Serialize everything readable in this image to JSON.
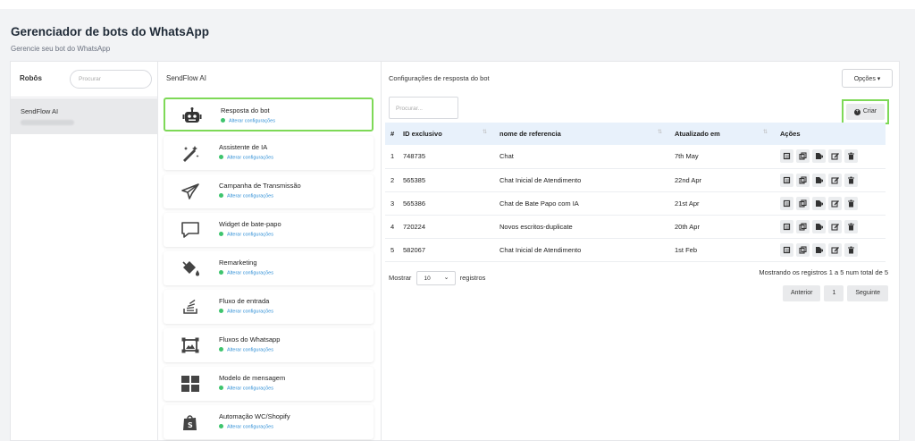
{
  "header": {
    "title": "Gerenciador de bots do WhatsApp",
    "subtitle": "Gerencie seu bot do WhatsApp"
  },
  "bots_panel": {
    "title": "Robôs",
    "search_placeholder": "Procurar",
    "items": [
      {
        "name": "SendFlow AI"
      }
    ]
  },
  "features_panel": {
    "title": "SendFlow AI",
    "items": [
      {
        "name": "Resposta do bot",
        "sub": "Alterar configurações",
        "icon": "robot-icon",
        "active": true
      },
      {
        "name": "Assistente de IA",
        "sub": "Alterar configurações",
        "icon": "magic-wand-icon"
      },
      {
        "name": "Campanha de Transmissão",
        "sub": "Alterar configurações",
        "icon": "paper-plane-icon"
      },
      {
        "name": "Widget de bate-papo",
        "sub": "Alterar configurações",
        "icon": "chat-bubble-icon"
      },
      {
        "name": "Remarketing",
        "sub": "Alterar configurações",
        "icon": "paint-bucket-icon"
      },
      {
        "name": "Fluxo de entrada",
        "sub": "Alterar configurações",
        "icon": "stack-icon"
      },
      {
        "name": "Fluxos do Whatsapp",
        "sub": "Alterar configurações",
        "icon": "frame-icon"
      },
      {
        "name": "Modelo de mensagem",
        "sub": "Alterar configurações",
        "icon": "grid-icon"
      },
      {
        "name": "Automação WC/Shopify",
        "sub": "Alterar configurações",
        "icon": "shopify-bag-icon"
      }
    ]
  },
  "config_panel": {
    "title": "Configurações de resposta do bot",
    "options_label": "Opções",
    "search_placeholder": "Procurar...",
    "create_label": "Criar",
    "columns": [
      "#",
      "ID exclusivo",
      "nome de referencia",
      "Atualizado em",
      "Ações"
    ],
    "rows": [
      {
        "n": "1",
        "id": "748735",
        "name": "Chat",
        "updated": "7th May"
      },
      {
        "n": "2",
        "id": "565385",
        "name": "Chat Inicial de Atendimento",
        "updated": "22nd Apr"
      },
      {
        "n": "3",
        "id": "565386",
        "name": "Chat de Bate Papo com IA",
        "updated": "21st Apr"
      },
      {
        "n": "4",
        "id": "720224",
        "name": "Novos escritos-duplicate",
        "updated": "20th Apr"
      },
      {
        "n": "5",
        "id": "582067",
        "name": "Chat Inicial de Atendimento",
        "updated": "1st Feb"
      }
    ],
    "show_label": "Mostrar",
    "page_size": "10",
    "records_label": "registros",
    "info": "Mostrando os registros 1 a 5 num total de 5",
    "pager": {
      "prev": "Anterior",
      "page": "1",
      "next": "Seguinte"
    }
  },
  "colors": {
    "highlight": "#7ed957",
    "link": "#2f8fd6",
    "status_dot": "#3ec46d",
    "table_header": "#e8f1fb"
  }
}
